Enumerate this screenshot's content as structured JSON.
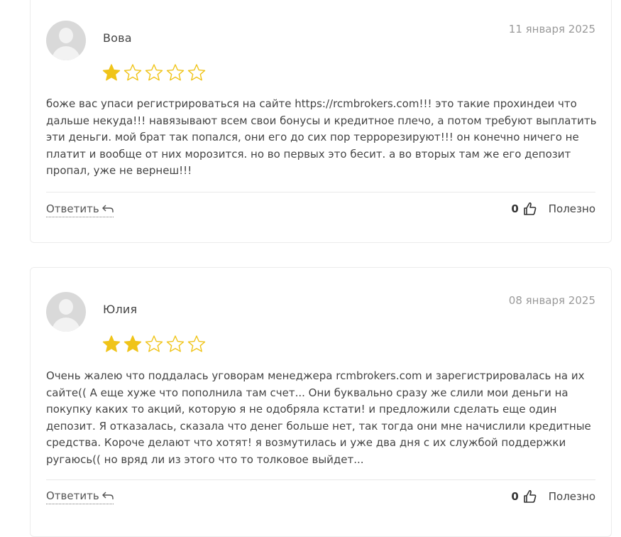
{
  "accent": "#f0c419",
  "reviews": [
    {
      "author": "Вова",
      "date": "11 января 2025",
      "rating": 1,
      "max_rating": 5,
      "text": "боже вас упаси регистрироваться на сайте https://rcmbrokers.com!!! это такие прохиндеи что дальше некуда!!! навязывают всем свои бонусы и кредитное плечо, а потом требуют выплатить эти деньги. мой брат так попался, они его до сих пор террорезируют!!! он конечно ничего не платит и вообще от них морозится. но во первых это бесит. а во вторых там же его депозит пропал, уже не вернеш!!!",
      "reply_label": "Ответить",
      "useful_count": "0",
      "useful_label": "Полезно"
    },
    {
      "author": "Юлия",
      "date": "08 января 2025",
      "rating": 2,
      "max_rating": 5,
      "text": "Очень жалею что поддалась уговорам менеджера rcmbrokers.com и зарегистрировалась на их сайте(( А еще хуже что пополнила там счет... Они буквально сразу же слили мои деньги на покупку каких то акций, которую я не одобряла кстати! и предложили сделать еще один депозит. Я отказалась, сказала что денег больше нет, так тогда они мне начислили кредитные средства. Короче делают что хотят! я возмутилась и уже два дня с их службой поддержки ругаюсь(( но вряд ли из этого что то толковое выйдет...",
      "reply_label": "Ответить",
      "useful_count": "0",
      "useful_label": "Полезно"
    }
  ]
}
